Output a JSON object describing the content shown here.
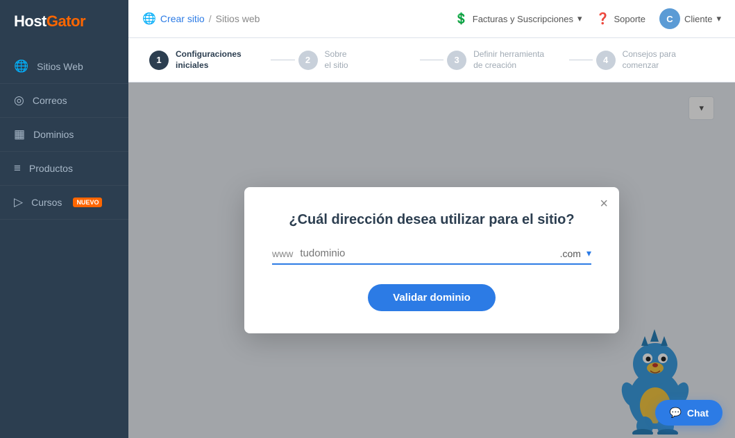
{
  "sidebar": {
    "logo": "HostGator",
    "items": [
      {
        "id": "sitios-web",
        "label": "Sitios Web",
        "icon": "🌐"
      },
      {
        "id": "correos",
        "label": "Correos",
        "icon": "◎"
      },
      {
        "id": "dominios",
        "label": "Dominios",
        "icon": "▦"
      },
      {
        "id": "productos",
        "label": "Productos",
        "icon": "≡"
      },
      {
        "id": "cursos",
        "label": "Cursos",
        "icon": "▷",
        "badge": "NUEVO"
      }
    ]
  },
  "topnav": {
    "globe_icon": "🌐",
    "breadcrumb_current": "Crear sitio",
    "breadcrumb_sep": "/",
    "breadcrumb_parent": "Sitios web",
    "billing_icon": "💲",
    "billing_label": "Facturas y Suscripciones",
    "support_icon": "❓",
    "support_label": "Soporte",
    "avatar_letter": "C",
    "client_label": "Cliente"
  },
  "steps": [
    {
      "num": "1",
      "label": "Configuraciones\niniciales",
      "active": true
    },
    {
      "num": "2",
      "label": "Sobre\nel sitio",
      "active": false
    },
    {
      "num": "3",
      "label": "Definir herramienta\nde creación",
      "active": false
    },
    {
      "num": "4",
      "label": "Consejos para\ncomenzar",
      "active": false
    }
  ],
  "modal": {
    "title": "¿Cuál dirección desea utilizar para el sitio?",
    "www_prefix": "www",
    "domain_placeholder": "tudominio",
    "tld": ".com",
    "close_icon": "×",
    "validate_btn": "Validar dominio"
  },
  "chat": {
    "label": "Chat",
    "icon": "💬"
  }
}
